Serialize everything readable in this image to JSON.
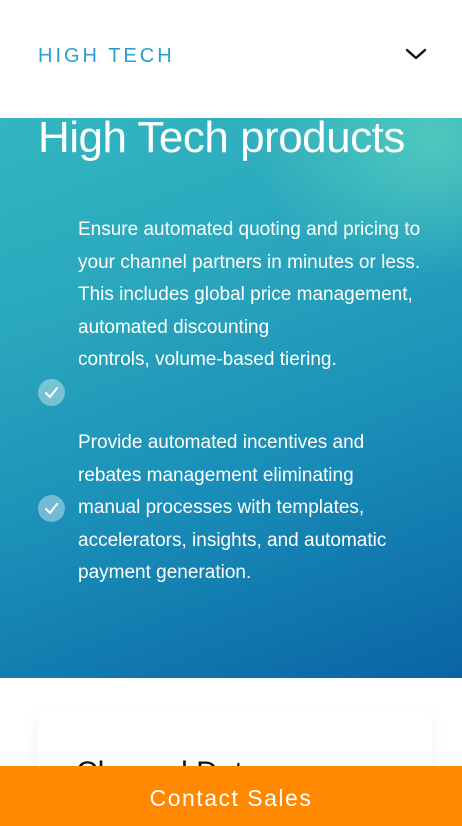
{
  "accordion": {
    "label": "HIGH TECH",
    "toggle_icon": "chevron-down-icon"
  },
  "hero": {
    "title": "High Tech products",
    "features": [
      {
        "icon": "check-circle-icon",
        "lines": [
          "Ensure automated quoting and pricing to",
          "your channel partners in minutes or less.",
          "This includes global price management,",
          "automated discounting",
          "controls, volume-based tiering."
        ]
      },
      {
        "icon": "check-circle-icon",
        "lines": [
          "Provide automated incentives and",
          "rebates management eliminating",
          "manual processes with templates,",
          "accelerators, insights, and automatic",
          "payment generation."
        ]
      }
    ]
  },
  "card": {
    "title": "Channel Data"
  },
  "cta": {
    "label": "Contact Sales"
  },
  "colors": {
    "accent": "#2a9fd0",
    "cta": "#ff8800",
    "gradient_top": "#33b6c0",
    "gradient_bottom": "#0a64a4"
  }
}
